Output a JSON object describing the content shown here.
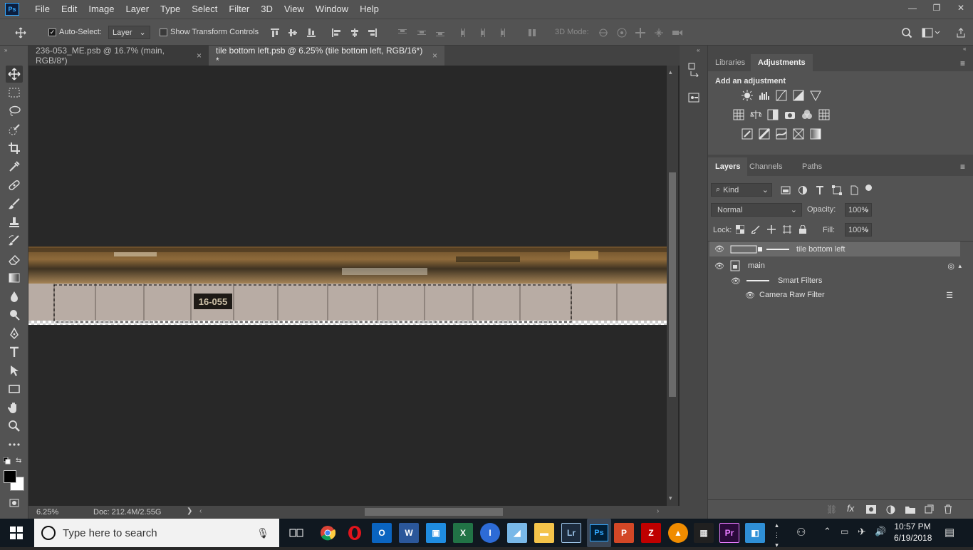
{
  "menubar": {
    "logo": "Ps",
    "items": [
      "File",
      "Edit",
      "Image",
      "Layer",
      "Type",
      "Select",
      "Filter",
      "3D",
      "View",
      "Window",
      "Help"
    ]
  },
  "options": {
    "auto_select_label": "Auto-Select:",
    "auto_select_value": "Layer",
    "show_transform_label": "Show Transform Controls",
    "mode_3d_label": "3D Mode:"
  },
  "tabs": [
    {
      "label": "236-053_ME.psb @ 16.7% (main, RGB/8*)",
      "close": "×"
    },
    {
      "label": "tile bottom left.psb @ 6.25% (tile bottom left, RGB/16*) *",
      "close": "×"
    }
  ],
  "canvas": {
    "plate_text": "16-055"
  },
  "status": {
    "zoom": "6.25%",
    "doc": "Doc: 212.4M/2.55G",
    "arrow": "❯"
  },
  "panels": {
    "top_tabs": [
      "Libraries",
      "Adjustments"
    ],
    "adjust_title": "Add an adjustment",
    "layer_tabs": [
      "Layers",
      "Channels",
      "Paths"
    ],
    "filter_kind": "Kind",
    "blend_mode": "Normal",
    "opacity_label": "Opacity:",
    "opacity_value": "100%",
    "lock_label": "Lock:",
    "fill_label": "Fill:",
    "fill_value": "100%",
    "layers": [
      {
        "name": "tile bottom left"
      },
      {
        "name": "main"
      },
      {
        "name": "Smart Filters"
      },
      {
        "name": "Camera Raw Filter"
      }
    ]
  },
  "taskbar": {
    "search_placeholder": "Type here to search",
    "time": "10:57 PM",
    "date": "6/19/2018",
    "apps": [
      "Chrome",
      "Opera",
      "Outlook",
      "Word",
      "Notepad",
      "Excel",
      "Reader",
      "Photos",
      "Explorer",
      "Lr",
      "Ps",
      "PowerPoint",
      "FileZilla",
      "VLC",
      "Calculator",
      "Pr",
      "Network"
    ]
  }
}
